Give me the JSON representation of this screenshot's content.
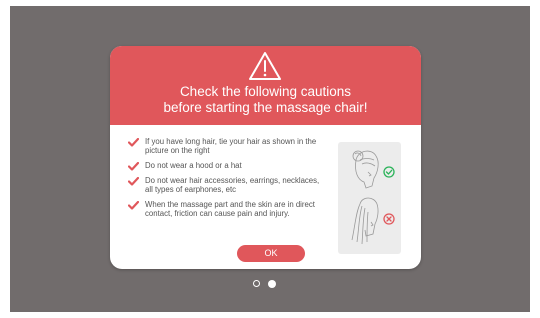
{
  "dialog": {
    "title_line1": "Check the following cautions",
    "title_line2": "before starting the massage chair!",
    "icon": "warning-triangle-icon",
    "cautions": [
      {
        "text": "If you have long hair, tie your hair as shown in the picture on the right"
      },
      {
        "text": "Do not wear a hood or a hat"
      },
      {
        "text": "Do not wear hair accessories, earrings, necklaces, all types of earphones, etc"
      },
      {
        "text": "When the massage part and the skin are in direct contact, friction can cause pain and injury."
      }
    ],
    "ok_label": "OK",
    "illustration": {
      "correct_icon": "check-circle-icon",
      "wrong_icon": "x-circle-icon"
    }
  },
  "pager": {
    "pages": 2,
    "current": 2
  },
  "colors": {
    "background": "#716c6c",
    "accent": "#e0575b",
    "correct": "#2bb35a",
    "wrong": "#e0575b"
  }
}
